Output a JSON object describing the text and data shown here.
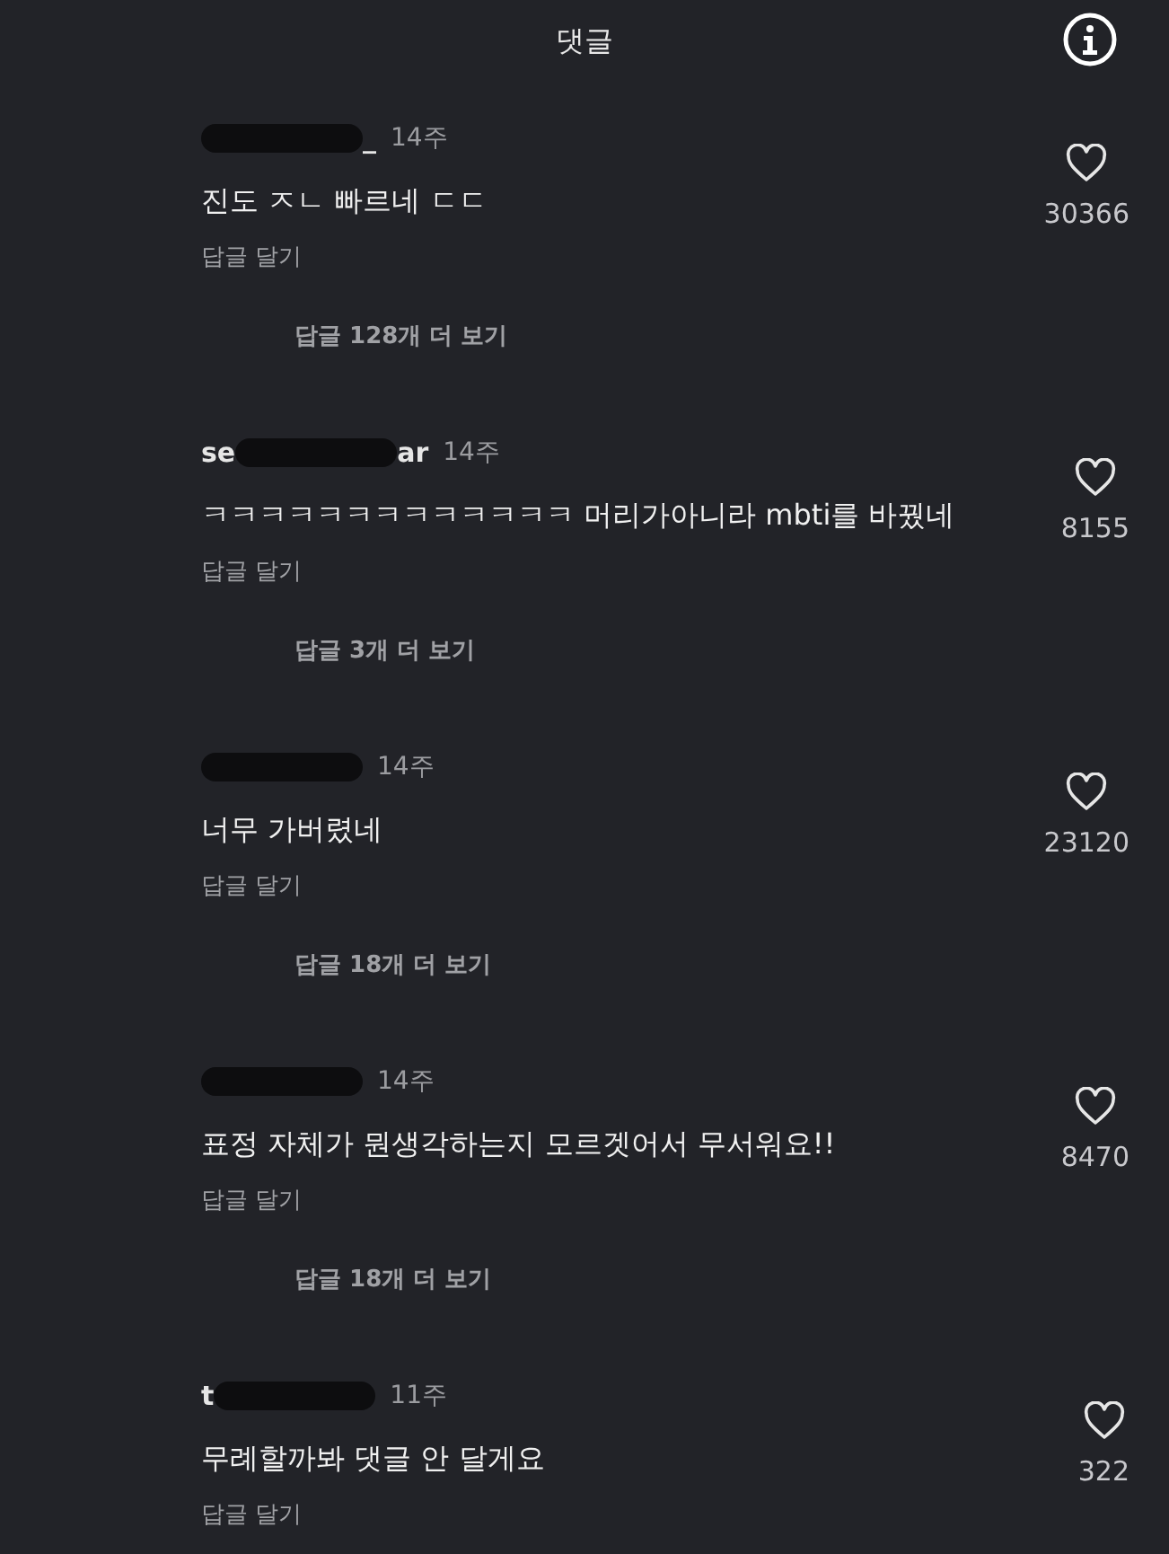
{
  "header": {
    "title": "댓글"
  },
  "comments": [
    {
      "username_suffix": "_",
      "time": "14주",
      "text": "진도 ㅈㄴ 빠르네 ㄷㄷ",
      "reply_action": "답글 달기",
      "more_replies": "답글 128개 더 보기",
      "likes": "30366"
    },
    {
      "username_prefix": "se",
      "username_suffix": "ar",
      "time": "14주",
      "text": "ㅋㅋㅋㅋㅋㅋㅋㅋㅋㅋㅋㅋㅋ 머리가아니라 mbti를 바꿨네",
      "reply_action": "답글 달기",
      "more_replies": "답글 3개 더 보기",
      "likes": "8155"
    },
    {
      "time": "14주",
      "text": "너무 가버렸네",
      "reply_action": "답글 달기",
      "more_replies": "답글 18개 더 보기",
      "likes": "23120"
    },
    {
      "time": "14주",
      "text": "표정 자체가 뭔생각하는지 모르겟어서 무서워요!!",
      "reply_action": "답글 달기",
      "more_replies": "답글 18개 더 보기",
      "likes": "8470"
    },
    {
      "username_prefix": "t",
      "time": "11주",
      "text": "무례할까봐 댓글 안 달게요",
      "reply_action": "답글 달기",
      "likes": "322"
    }
  ]
}
